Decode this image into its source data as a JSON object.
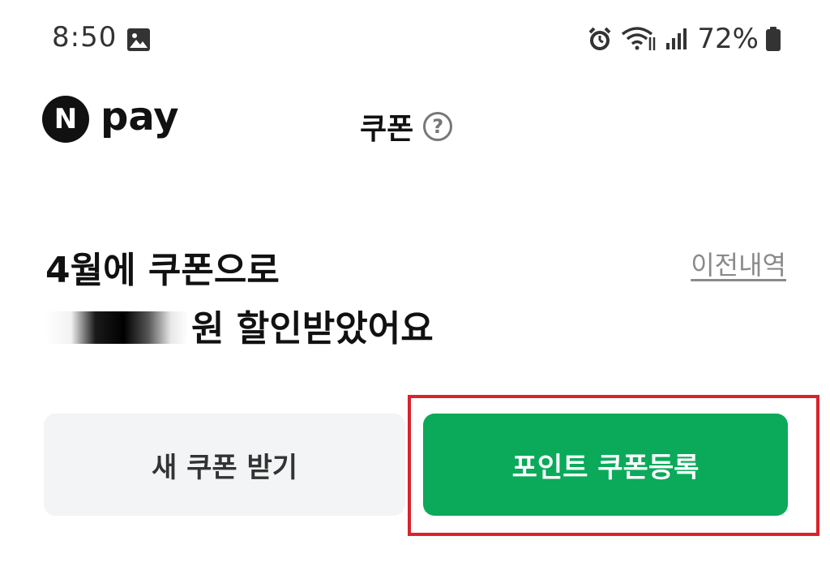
{
  "status_bar": {
    "time": "8:50",
    "battery": "72%",
    "icons": [
      "gallery-icon",
      "alarm-icon",
      "wifi-icon",
      "signal-icon",
      "battery-icon"
    ]
  },
  "header": {
    "logo_letter": "N",
    "logo_text": "pay",
    "title": "쿠폰",
    "help_symbol": "?"
  },
  "summary": {
    "line1": "4월에 쿠폰으로",
    "line2_suffix": "원 할인받았어요"
  },
  "history_link": "이전내역",
  "buttons": {
    "new_coupon": "새 쿠폰 받기",
    "register_point_coupon": "포인트 쿠폰등록"
  },
  "colors": {
    "accent_green": "#0aaa5a",
    "highlight_red": "#d9232d",
    "secondary_button_bg": "#f3f4f6"
  }
}
